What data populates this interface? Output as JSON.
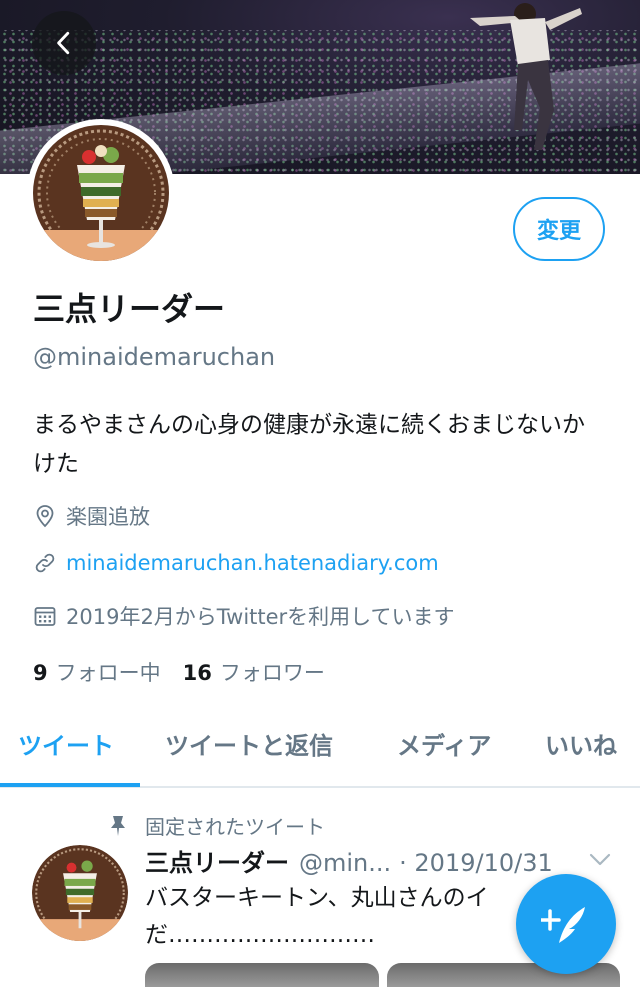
{
  "profile": {
    "display_name": "三点リーダー",
    "handle": "@minaidemaruchan",
    "bio": "まるやまさんの心身の健康が永遠に続くおまじないかけた",
    "location": "楽園追放",
    "url": "minaidemaruchan.hatenadiary.com",
    "joined": "2019年2月からTwitterを利用しています",
    "following_count": "9",
    "following_label": "フォロー中",
    "followers_count": "16",
    "followers_label": "フォロワー",
    "edit_label": "変更"
  },
  "tabs": [
    {
      "label": "ツイート",
      "active": true
    },
    {
      "label": "ツイートと返信",
      "active": false
    },
    {
      "label": "メディア",
      "active": false
    },
    {
      "label": "いいね",
      "active": false
    }
  ],
  "pinned_tweet": {
    "pinned_label": "固定されたツイート",
    "author_name": "三点リーダー",
    "author_handle": "@min...",
    "date": "· 2019/10/31",
    "text": "バスターキートン、丸山さんのイ\nだ………………………"
  },
  "icons": {
    "back": "chevron-left-icon",
    "location": "map-pin-icon",
    "link": "link-icon",
    "calendar": "calendar-icon",
    "pin": "pushpin-icon",
    "more": "chevron-down-icon",
    "compose": "compose-tweet-icon"
  },
  "colors": {
    "accent": "#1da1f2",
    "text_primary": "#14171a",
    "text_secondary": "#657786",
    "divider": "#e1e8ed"
  }
}
